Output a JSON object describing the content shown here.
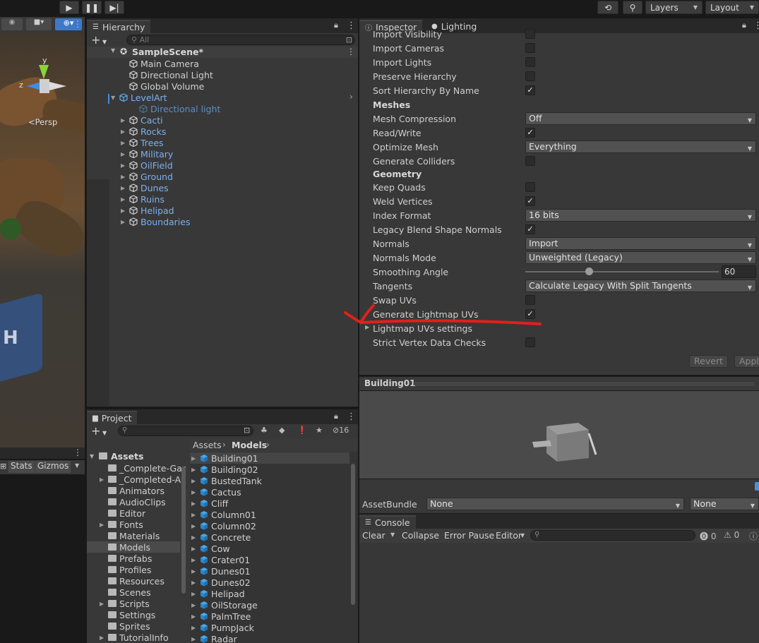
{
  "toolbar": {
    "play_icon": "play-icon",
    "pause_icon": "pause-icon",
    "step_icon": "step-icon",
    "layers_label": "Layers",
    "layout_label": "Layout"
  },
  "scene": {
    "gizmo_y": "y",
    "gizmo_z": "z",
    "persp_label": "<Persp",
    "stats_label": "Stats",
    "gizmos_label": "Gizmos"
  },
  "hierarchy": {
    "tab_label": "Hierarchy",
    "search_placeholder": "All",
    "scene_name": "SampleScene*",
    "items": [
      {
        "label": "Main Camera"
      },
      {
        "label": "Directional Light"
      },
      {
        "label": "Global Volume"
      },
      {
        "label": "LevelArt"
      },
      {
        "label": "Directional light"
      },
      {
        "label": "Cacti"
      },
      {
        "label": "Rocks"
      },
      {
        "label": "Trees"
      },
      {
        "label": "Military"
      },
      {
        "label": "OilField"
      },
      {
        "label": "Ground"
      },
      {
        "label": "Dunes"
      },
      {
        "label": "Ruins"
      },
      {
        "label": "Helipad"
      },
      {
        "label": "Boundaries"
      }
    ]
  },
  "inspector": {
    "tab_inspector": "Inspector",
    "tab_lighting": "Lighting",
    "rows": [
      {
        "label": "Import Visibility",
        "checked": false
      },
      {
        "label": "Import Cameras",
        "checked": false
      },
      {
        "label": "Import Lights",
        "checked": false
      },
      {
        "label": "Preserve Hierarchy",
        "checked": false
      },
      {
        "label": "Sort Hierarchy By Name",
        "checked": true
      }
    ],
    "meshes_header": "Meshes",
    "mesh_compression_label": "Mesh Compression",
    "mesh_compression_value": "Off",
    "read_write_label": "Read/Write",
    "optimize_mesh_label": "Optimize Mesh",
    "optimize_mesh_value": "Everything",
    "generate_colliders_label": "Generate Colliders",
    "geometry_header": "Geometry",
    "keep_quads_label": "Keep Quads",
    "weld_vertices_label": "Weld Vertices",
    "index_format_label": "Index Format",
    "index_format_value": "16 bits",
    "legacy_blend_label": "Legacy Blend Shape Normals",
    "normals_label": "Normals",
    "normals_value": "Import",
    "normals_mode_label": "Normals Mode",
    "normals_mode_value": "Unweighted (Legacy)",
    "smoothing_angle_label": "Smoothing Angle",
    "smoothing_angle_value": "60",
    "smoothing_angle_fraction": 0.33,
    "tangents_label": "Tangents",
    "tangents_value": "Calculate Legacy With Split Tangents",
    "swap_uvs_label": "Swap UVs",
    "gen_lightmap_label": "Generate Lightmap UVs",
    "lightmap_settings_label": "Lightmap UVs settings",
    "strict_vertex_label": "Strict Vertex Data Checks",
    "revert_label": "Revert",
    "apply_label": "Apply",
    "preview_title": "Building01",
    "assetbundle_label": "AssetBundle",
    "assetbundle_value": "None",
    "assetbundle_variant": "None",
    "annotation_color": "#e0201c"
  },
  "project": {
    "tab_label": "Project",
    "hidden_count": "16",
    "breadcrumb_root": "Assets",
    "breadcrumb_current": "Models",
    "assets_label": "Assets",
    "folders": [
      {
        "label": "_Complete-Gar",
        "expandable": false
      },
      {
        "label": "_Completed-As",
        "expandable": true
      },
      {
        "label": "Animators",
        "expandable": false
      },
      {
        "label": "AudioClips",
        "expandable": false
      },
      {
        "label": "Editor",
        "expandable": false
      },
      {
        "label": "Fonts",
        "expandable": true
      },
      {
        "label": "Materials",
        "expandable": false
      },
      {
        "label": "Models",
        "expandable": false
      },
      {
        "label": "Prefabs",
        "expandable": false
      },
      {
        "label": "Profiles",
        "expandable": false
      },
      {
        "label": "Resources",
        "expandable": false
      },
      {
        "label": "Scenes",
        "expandable": false
      },
      {
        "label": "Scripts",
        "expandable": true
      },
      {
        "label": "Settings",
        "expandable": false
      },
      {
        "label": "Sprites",
        "expandable": false
      },
      {
        "label": "TutorialInfo",
        "expandable": true
      }
    ],
    "files": [
      "Building01",
      "Building02",
      "BustedTank",
      "Cactus",
      "Cliff",
      "Column01",
      "Column02",
      "Concrete",
      "Cow",
      "Crater01",
      "Dunes01",
      "Dunes02",
      "Helipad",
      "OilStorage",
      "PalmTree",
      "PumpJack",
      "Radar"
    ]
  },
  "console": {
    "tab_label": "Console",
    "clear_label": "Clear",
    "collapse_label": "Collapse",
    "error_pause_label": "Error Pause",
    "editor_label": "Editor",
    "error_count": "0",
    "warning_count": "0"
  }
}
